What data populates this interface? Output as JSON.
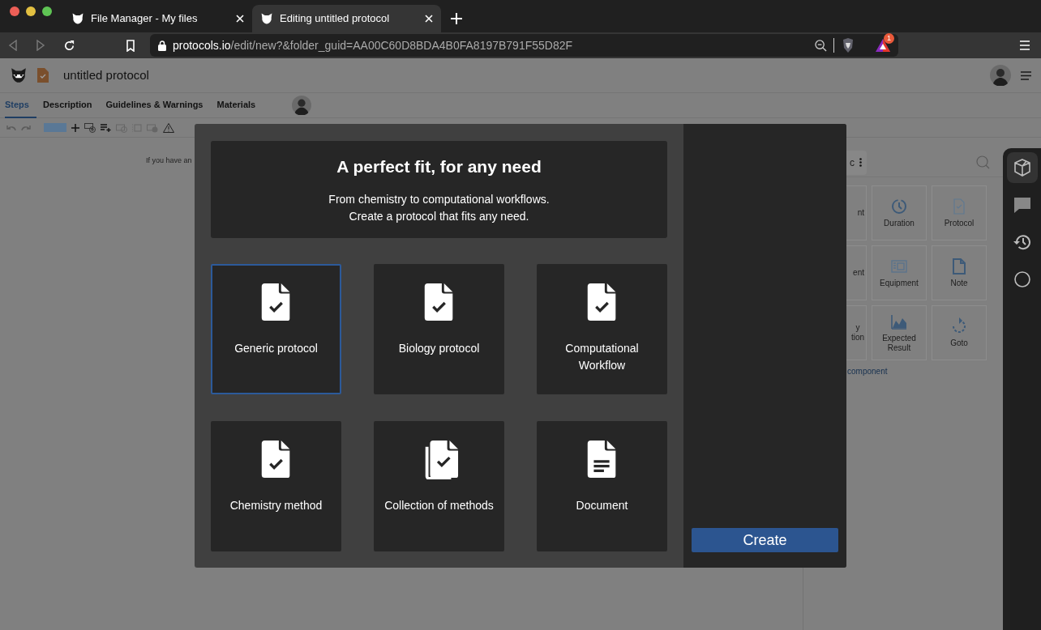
{
  "browser": {
    "tabs": [
      {
        "title": "File Manager - My files",
        "selected": false
      },
      {
        "title": "Editing untitled protocol",
        "selected": true
      }
    ],
    "url": {
      "host": "protocols.io",
      "path": "/edit/new?&folder_guid=AA00C60D8BDA4B0FA8197B791F55D82F"
    },
    "rewards_badge": "1"
  },
  "app": {
    "title": "untitled protocol",
    "tabs": [
      {
        "label": "Steps",
        "selected": true
      },
      {
        "label": "Description",
        "selected": false
      },
      {
        "label": "Guidelines & Warnings",
        "selected": false
      },
      {
        "label": "Materials",
        "selected": false
      }
    ],
    "hint": "If you have an",
    "components_menu": "c",
    "components": [
      {
        "kind": "partial",
        "lines": [
          "nt"
        ]
      },
      {
        "kind": "duration",
        "lines": [
          "Duration"
        ]
      },
      {
        "kind": "protocol",
        "lines": [
          "Protocol"
        ]
      },
      {
        "kind": "partial",
        "lines": [
          "ent"
        ]
      },
      {
        "kind": "equipment",
        "lines": [
          "Equipment"
        ]
      },
      {
        "kind": "note",
        "lines": [
          "Note"
        ]
      },
      {
        "kind": "partial",
        "lines": [
          "y",
          "tion"
        ]
      },
      {
        "kind": "result",
        "lines": [
          "Expected",
          "Result"
        ]
      },
      {
        "kind": "goto",
        "lines": [
          "Goto"
        ]
      }
    ],
    "components_link": "component",
    "rail": [
      {
        "kind": "cube",
        "selected": true
      },
      {
        "kind": "chat",
        "selected": false
      },
      {
        "kind": "history",
        "selected": false
      },
      {
        "kind": "circle",
        "selected": false
      }
    ]
  },
  "modal": {
    "title": "A perfect fit, for any need",
    "subtitle_lines": [
      "From chemistry to computational workflows.",
      "Create a protocol that fits any need."
    ],
    "options": [
      {
        "title": "Generic protocol",
        "kind": "protocol",
        "selected": true
      },
      {
        "title": "Biology protocol",
        "kind": "protocol",
        "selected": false
      },
      {
        "title": "Computational Workflow",
        "kind": "protocol",
        "selected": false
      },
      {
        "title": "Chemistry method",
        "kind": "protocol",
        "selected": false
      },
      {
        "title": "Collection of methods",
        "kind": "collection",
        "selected": false
      },
      {
        "title": "Document",
        "kind": "document",
        "selected": false
      }
    ],
    "create_button": "Create"
  }
}
